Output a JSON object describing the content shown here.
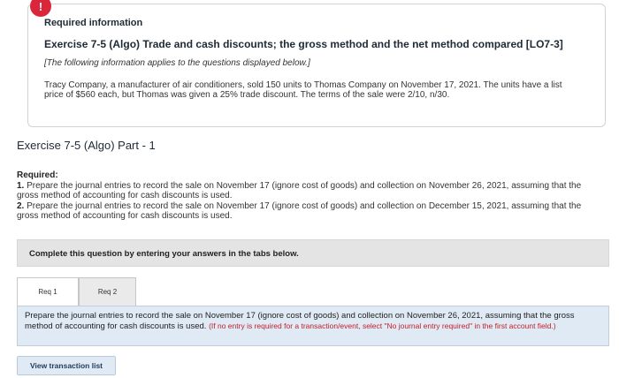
{
  "info": {
    "alert_icon": "!",
    "heading": "Required information",
    "title": "Exercise 7-5 (Algo) Trade and cash discounts; the gross method and the net method compared [LO7-3]",
    "note": "[The following information applies to the questions displayed below.]",
    "body": "Tracy Company, a manufacturer of air conditioners, sold 150 units to Thomas Company on November 17, 2021. The units have a list price of $560 each, but Thomas was given a 25% trade discount. The terms of the sale were 2/10, n/30."
  },
  "part": {
    "title": "Exercise 7-5 (Algo) Part - 1"
  },
  "required": {
    "label": "Required:",
    "item1_num": "1.",
    "item1": "Prepare the journal entries to record the sale on November 17 (ignore cost of goods) and collection on November 26, 2021, assuming that the gross method of accounting for cash discounts is used.",
    "item2_num": "2.",
    "item2": "Prepare the journal entries to record the sale on November 17 (ignore cost of goods) and collection on December 15, 2021, assuming that the gross method of accounting for cash discounts is used."
  },
  "complete_bar": {
    "text": "Complete this question by entering your answers in the tabs below."
  },
  "tabs": [
    {
      "label": "Req 1"
    },
    {
      "label": "Req 2"
    }
  ],
  "prompt": {
    "text": "Prepare the journal entries to record the sale on November 17 (ignore cost of goods) and collection on November 26, 2021, assuming that the gross method of accounting for cash discounts is used.",
    "hint": "(If no entry is required for a transaction/event, select \"No journal entry required\" in the first account field.)"
  },
  "buttons": {
    "view_transaction_list": "View transaction list"
  }
}
